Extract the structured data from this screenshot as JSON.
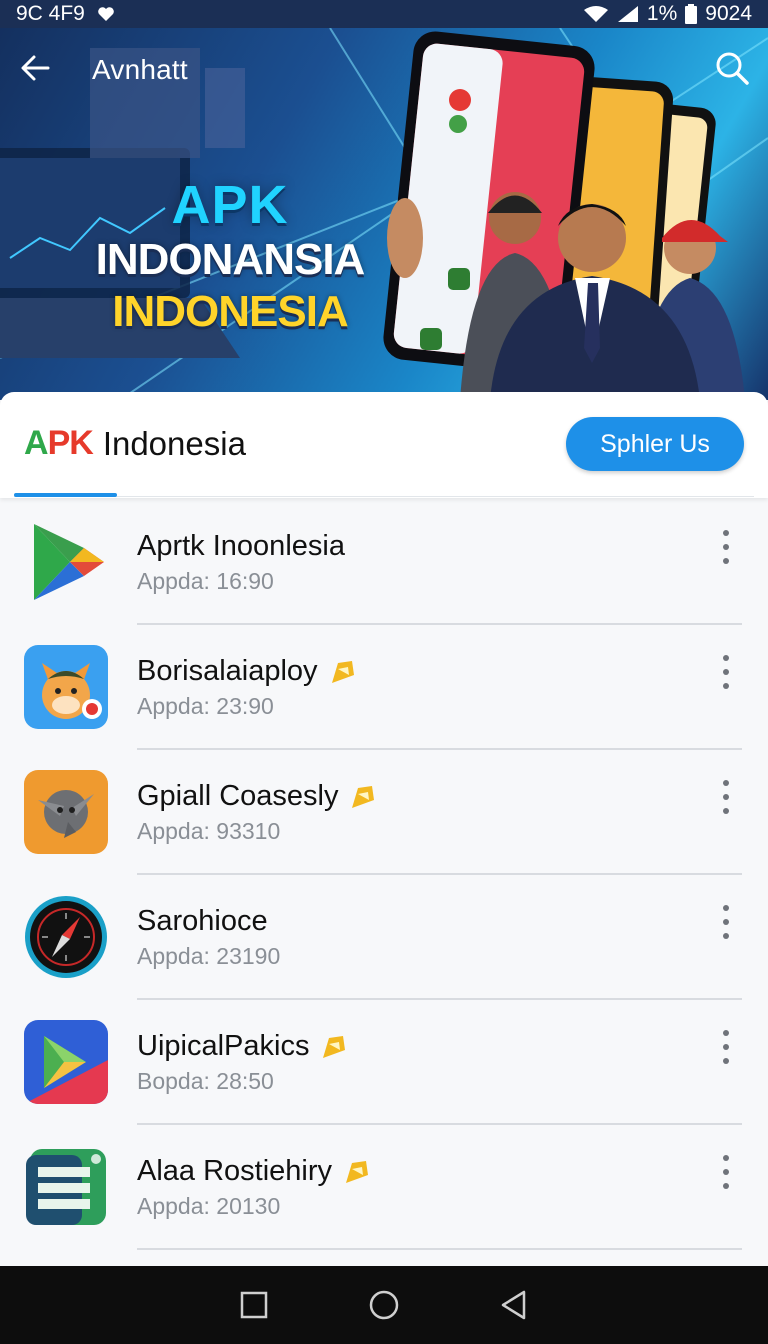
{
  "status_bar": {
    "left_text": "9C 4F9",
    "right_battery": "1%",
    "right_time": "9024"
  },
  "app_bar": {
    "title": "Avnhatt"
  },
  "hero": {
    "line1": "APK",
    "line2": "INDONANSIA",
    "line3": "INDONESIA"
  },
  "header": {
    "logo_apk": [
      "A",
      "P",
      "K"
    ],
    "logo_name": "Indonesia",
    "cta_label": "Sphler Us"
  },
  "apps": [
    {
      "title": "Aprtk Inoonlesia",
      "subtitle": "Appda: 16:90",
      "badge": false,
      "icon": "play-store-icon"
    },
    {
      "title": "Borisalaiaploy",
      "subtitle": "Appda: 23:90",
      "badge": true,
      "icon": "fox-mascot-icon"
    },
    {
      "title": "Gpiall Coasesly",
      "subtitle": "Appda: 93310",
      "badge": true,
      "icon": "gear-blade-icon"
    },
    {
      "title": "Sarohioce",
      "subtitle": "Appda: 23190",
      "badge": false,
      "icon": "compass-icon"
    },
    {
      "title": "UipicalPakics",
      "subtitle": "Bopda: 28:50",
      "badge": true,
      "icon": "play-triangle-icon"
    },
    {
      "title": "Alaa Rostiehiry",
      "subtitle": "Appda: 20130",
      "badge": true,
      "icon": "document-stack-icon"
    }
  ],
  "colors": {
    "accent": "#1e90e8",
    "status_bg": "#1b2f55",
    "badge": "#f2b820"
  }
}
